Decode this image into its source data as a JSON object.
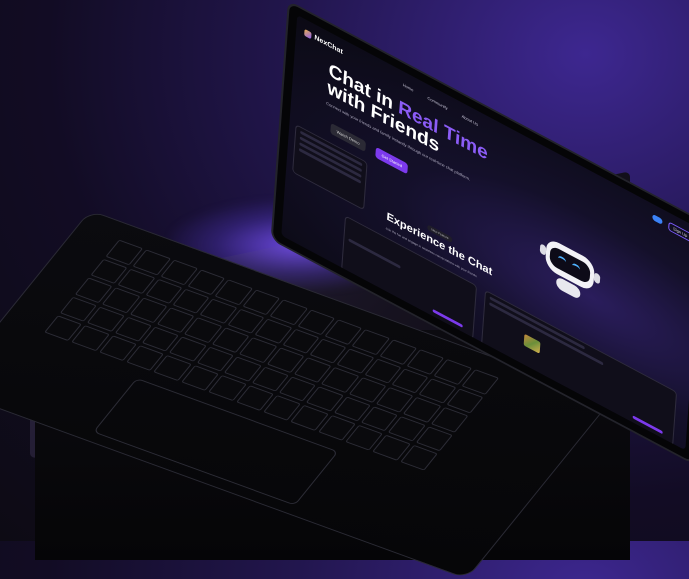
{
  "nav": {
    "logo_text": "NexChat",
    "links": [
      "Home",
      "Community",
      "About Us"
    ],
    "signup_label": "Sign Up"
  },
  "hero": {
    "title_line1_a": "Chat in ",
    "title_line1_b": "Real Time",
    "title_line2": "with Friends",
    "subtitle": "Connect with your friends and family instantly through our real-time chat platform.",
    "secondary_button": "Watch Demo",
    "primary_button": "Get Started"
  },
  "experience": {
    "badge": "New Feature",
    "title": "Experience the Chat",
    "subtitle": "Join the fun and engage in seamless conversations with your friends."
  },
  "colors": {
    "accent": "#8b5cf6",
    "button_primary": "#7c3aed",
    "background": "#0b0a14",
    "glow": "#7c54ff"
  }
}
